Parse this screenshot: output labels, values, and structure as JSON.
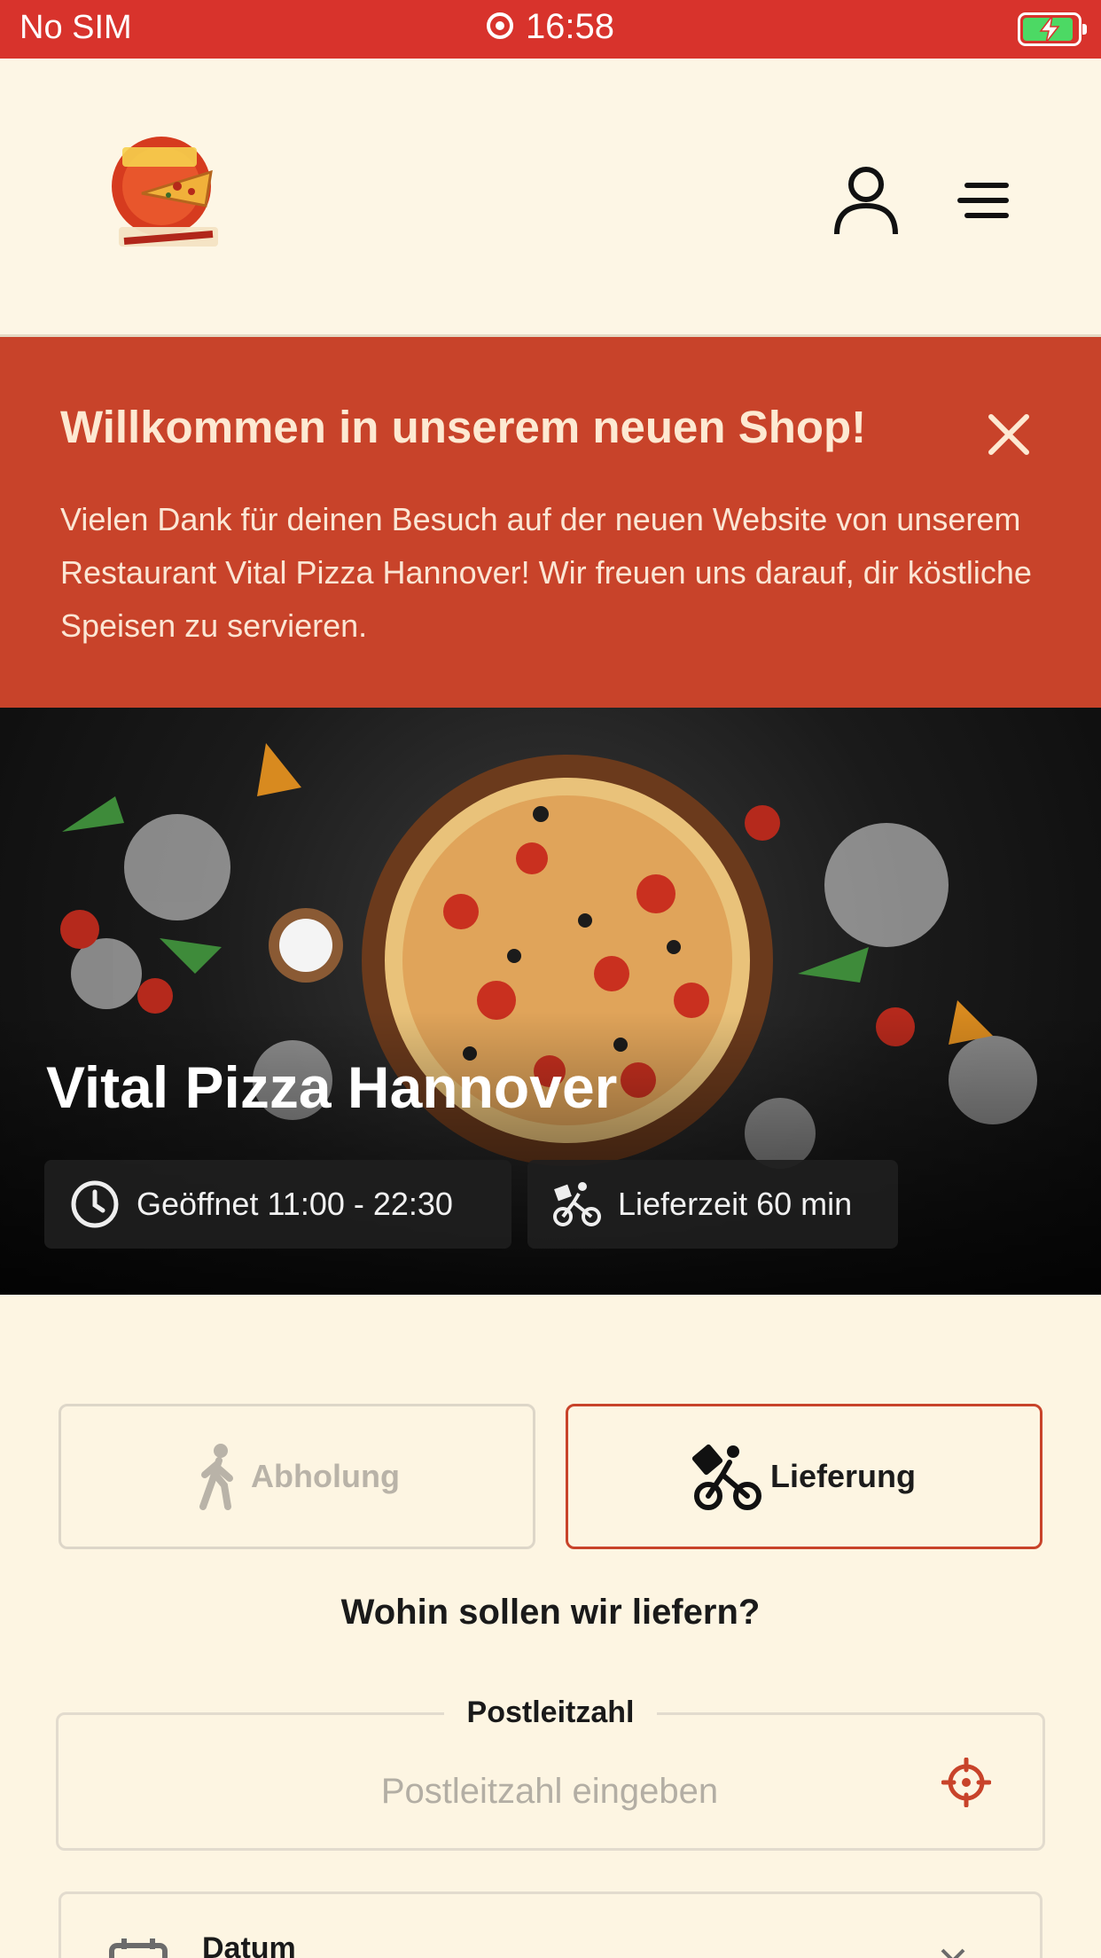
{
  "status_bar": {
    "carrier": "No SIM",
    "time": "16:58",
    "battery_state": "charging"
  },
  "header": {
    "logo_icon": "pizza-service-logo",
    "account_icon": "user-icon",
    "menu_icon": "hamburger-icon"
  },
  "banner": {
    "title": "Willkommen in unserem neuen Shop!",
    "text": "Vielen Dank für deinen Besuch auf der neuen Website von unserem Restaurant Vital Pizza Hannover! Wir freuen uns darauf, dir köstliche Speisen zu servieren.",
    "close_icon": "close-icon"
  },
  "hero": {
    "restaurant_name": "Vital Pizza Hannover",
    "hours_label": "Geöffnet 11:00 - 22:30",
    "delivery_time_label": "Lieferzeit 60 min"
  },
  "order_type": {
    "pickup_label": "Abholung",
    "delivery_label": "Lieferung",
    "selected": "delivery"
  },
  "delivery_form": {
    "question": "Wohin sollen wir liefern?",
    "zip_label": "Postleitzahl",
    "zip_placeholder": "Postleitzahl eingeben",
    "zip_value": "",
    "date_label": "Datum"
  },
  "colors": {
    "status_bar": "#d8332c",
    "banner": "#c8432a",
    "accent": "#c8432a",
    "page_background": "#fdf5e2"
  }
}
